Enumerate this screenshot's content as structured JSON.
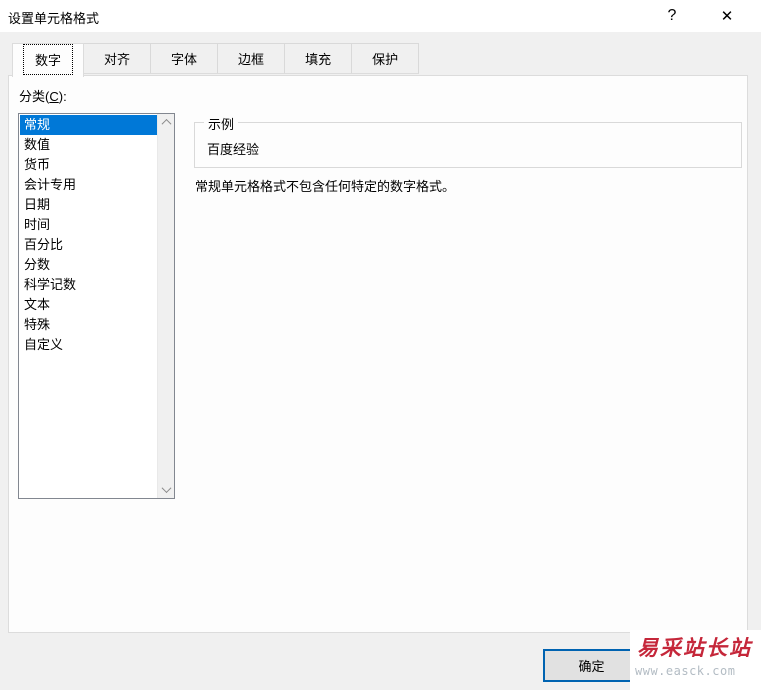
{
  "window": {
    "title": "设置单元格格式",
    "help_label": "?",
    "close_label": "✕"
  },
  "tabs": [
    {
      "label": "数字",
      "active": true
    },
    {
      "label": "对齐",
      "active": false
    },
    {
      "label": "字体",
      "active": false
    },
    {
      "label": "边框",
      "active": false
    },
    {
      "label": "填充",
      "active": false
    },
    {
      "label": "保护",
      "active": false
    }
  ],
  "number_tab": {
    "category_label": {
      "prefix": "分类(",
      "accelerator": "C",
      "suffix": "):"
    },
    "categories": [
      "常规",
      "数值",
      "货币",
      "会计专用",
      "日期",
      "时间",
      "百分比",
      "分数",
      "科学记数",
      "文本",
      "特殊",
      "自定义"
    ],
    "selected_category": "常规",
    "sample": {
      "group_label": "示例",
      "value": "百度经验"
    },
    "description": "常规单元格格式不包含任何特定的数字格式。"
  },
  "footer": {
    "ok_label": "确定"
  },
  "watermark": {
    "site_name": "易采站长站",
    "site_url": "www.easck.com"
  },
  "colors": {
    "selection_blue": "#0078d7",
    "default_button_border": "#0063b1",
    "watermark_red": "#c5273a",
    "dialog_background": "#f0f0f0",
    "titlebar_background": "#ffffff"
  }
}
